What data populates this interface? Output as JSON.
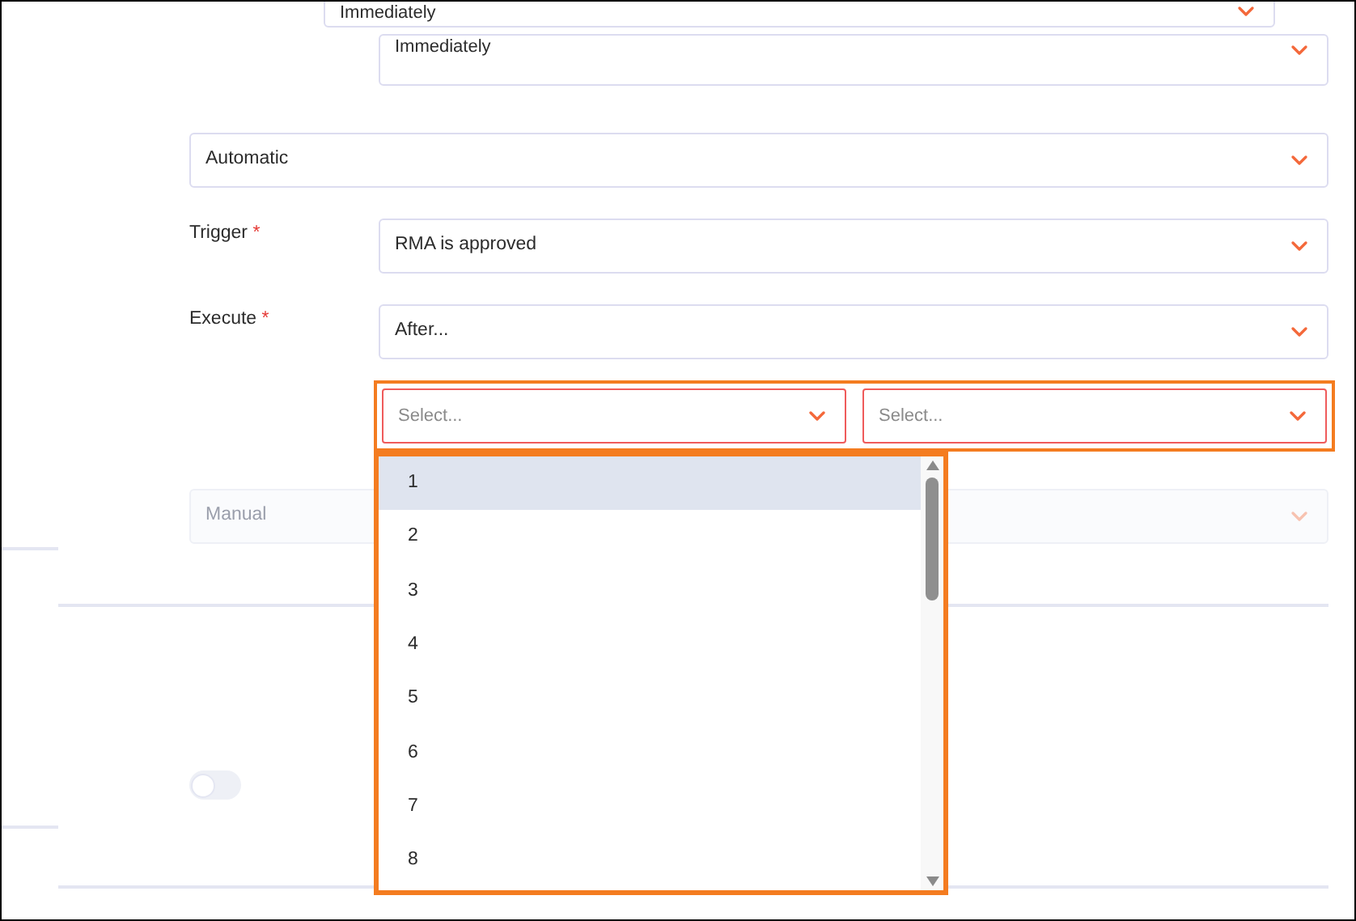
{
  "top_fields": [
    {
      "value": "Immediately"
    },
    {
      "value": "Immediately"
    }
  ],
  "mode_select": {
    "value": "Automatic"
  },
  "trigger": {
    "label": "Trigger",
    "required_mark": "*",
    "value": "RMA is approved"
  },
  "execute": {
    "label": "Execute",
    "required_mark": "*",
    "value": "After..."
  },
  "delay_selects": [
    {
      "placeholder": "Select..."
    },
    {
      "placeholder": "Select..."
    }
  ],
  "manual_select": {
    "value": "Manual",
    "disabled": true
  },
  "toggle": {
    "on": false,
    "disabled": true
  },
  "dropdown": {
    "options": [
      {
        "label": "1",
        "selected": true
      },
      {
        "label": "2",
        "selected": false
      },
      {
        "label": "3",
        "selected": false
      },
      {
        "label": "4",
        "selected": false
      },
      {
        "label": "5",
        "selected": false
      },
      {
        "label": "6",
        "selected": false
      },
      {
        "label": "7",
        "selected": false
      },
      {
        "label": "8",
        "selected": false
      }
    ]
  }
}
